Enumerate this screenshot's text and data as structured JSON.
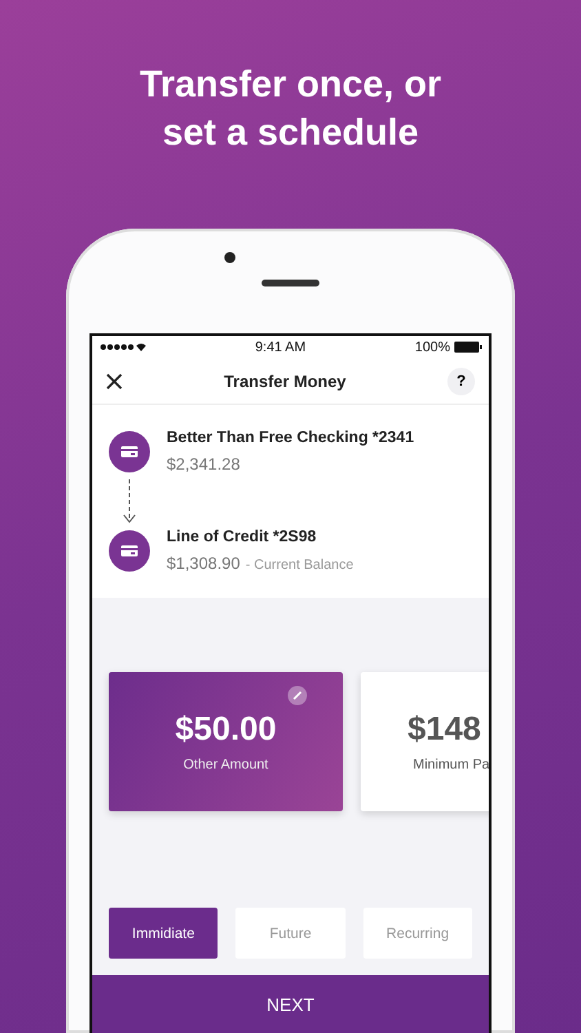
{
  "headline": "Transfer once, or\nset a schedule",
  "status_bar": {
    "time": "9:41 AM",
    "battery": "100%"
  },
  "nav": {
    "title": "Transfer Money",
    "help": "?"
  },
  "accounts": [
    {
      "name": "Better Than Free Checking *2341",
      "amount": "$2,341.28"
    },
    {
      "name": "Line of Credit *2S98",
      "amount": "$1,308.90",
      "note": "- Current Balance"
    }
  ],
  "amounts": [
    {
      "value": "$50.00",
      "label": "Other Amount",
      "selected": true
    },
    {
      "value": "$148",
      "label": "Minimum Pa",
      "selected": false
    }
  ],
  "timing": [
    {
      "label": "Immidiate",
      "selected": true
    },
    {
      "label": "Future",
      "selected": false
    },
    {
      "label": "Recurring",
      "selected": false
    }
  ],
  "next_button": "NEXT"
}
